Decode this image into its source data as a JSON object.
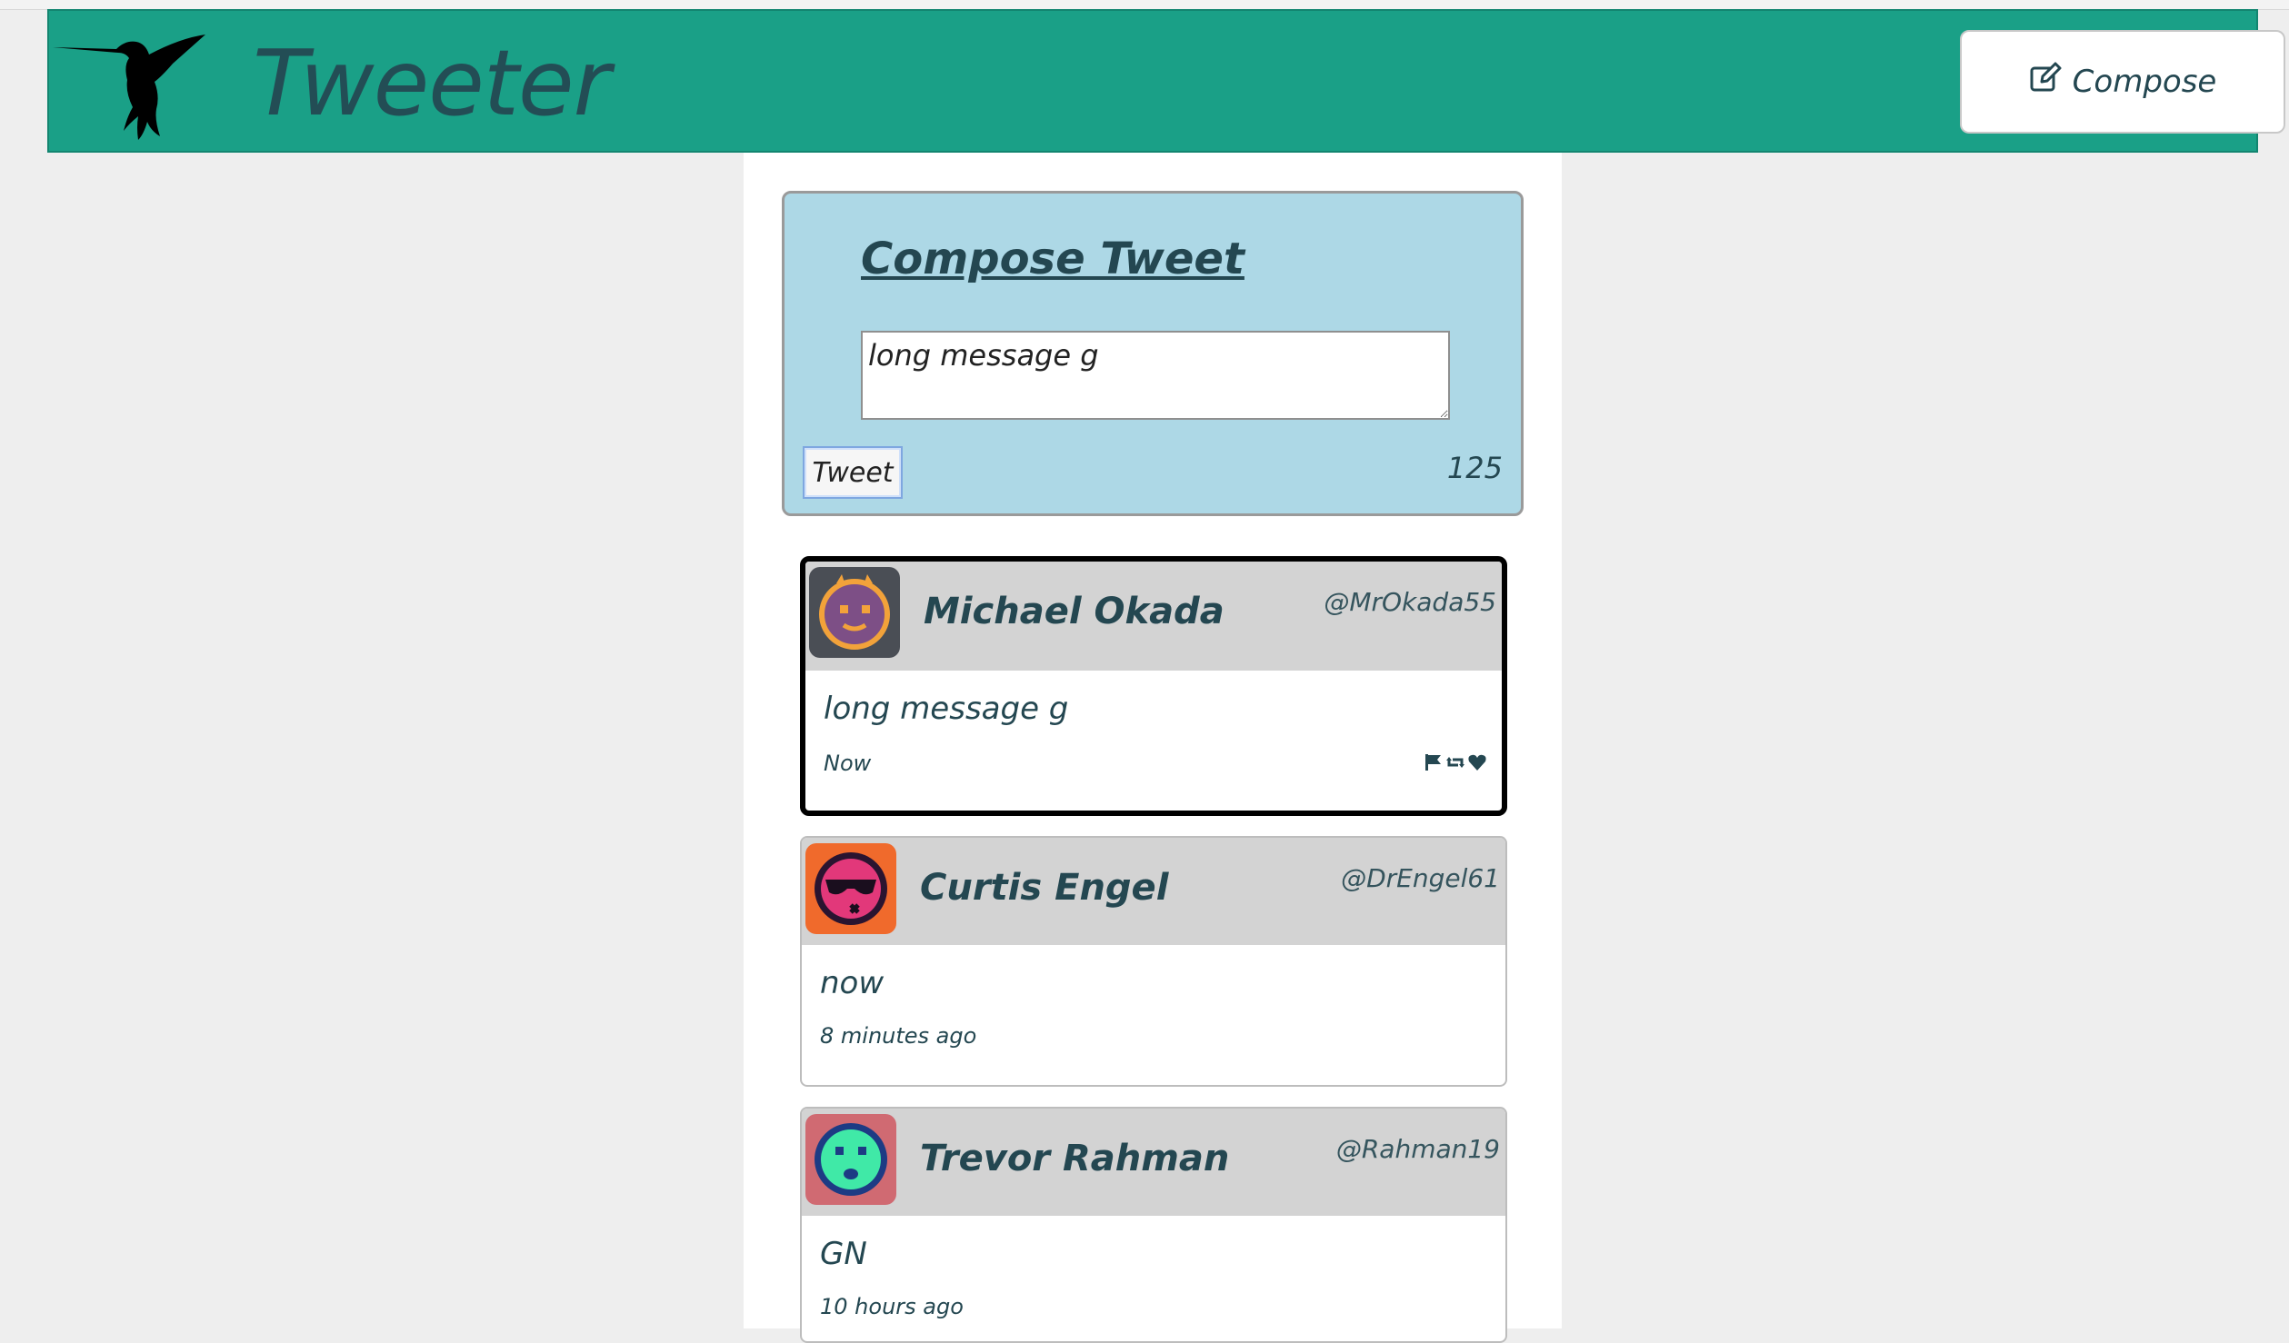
{
  "header": {
    "brand": "Tweeter",
    "compose_label": "Compose",
    "bg_color": "#1aa087"
  },
  "compose": {
    "title": "Compose Tweet",
    "text": "long message g",
    "tweet_button": "Tweet",
    "counter": "125",
    "bg_color": "#add8e6"
  },
  "tweets": [
    {
      "name": "Michael Okada",
      "handle": "@MrOkada55",
      "content": "long message g",
      "time": "Now",
      "avatar_icon": "purple-smiley-avatar-icon",
      "actions": [
        "flag-icon",
        "retweet-icon",
        "heart-icon"
      ]
    },
    {
      "name": "Curtis Engel",
      "handle": "@DrEngel61",
      "content": "now",
      "time": "8 minutes ago",
      "avatar_icon": "pink-sunglasses-avatar-icon"
    },
    {
      "name": "Trevor Rahman",
      "handle": "@Rahman19",
      "content": "GN",
      "time": "10 hours ago",
      "avatar_icon": "green-sad-avatar-icon"
    }
  ]
}
